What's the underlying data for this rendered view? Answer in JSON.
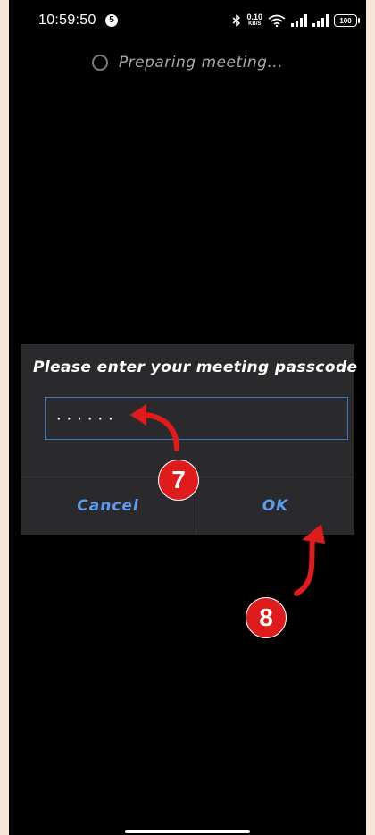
{
  "status_bar": {
    "time": "10:59:50",
    "notification_count": "5",
    "net_speed_value": "0.10",
    "net_speed_unit": "KB/S",
    "battery": "100"
  },
  "loading": {
    "text": "Preparing meeting..."
  },
  "dialog": {
    "title": "Please enter your meeting passcode",
    "passcode_value": "······",
    "cancel_label": "Cancel",
    "ok_label": "OK",
    "accent_color": "#5b9bf0"
  },
  "annotations": {
    "step_7": "7",
    "step_8": "8",
    "color": "#e01b1b"
  },
  "icons": [
    "bluetooth-icon",
    "wifi-icon",
    "signal-icon",
    "battery-icon",
    "spinner-icon"
  ]
}
